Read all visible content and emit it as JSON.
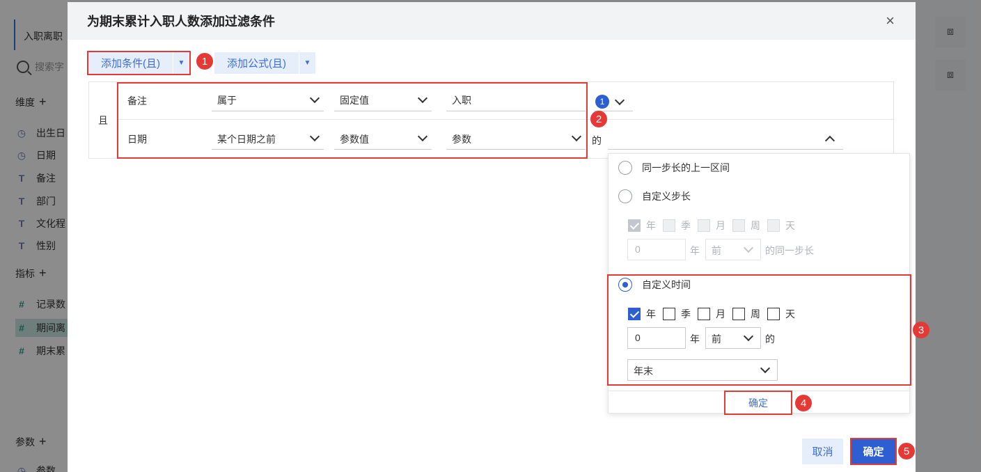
{
  "background": {
    "tab_label": "入职离职",
    "search_placeholder": "搜索字",
    "dimension_section": "维度",
    "dimension_fields": [
      "出生日",
      "日期",
      "备注",
      "部门",
      "文化程",
      "性别"
    ],
    "metric_section": "指标",
    "metric_fields": [
      "记录数",
      "期间离",
      "期末累"
    ],
    "param_section": "参数",
    "param_field": "参数"
  },
  "dialog": {
    "title": "为期末累计入职人数添加过滤条件",
    "close_icon": "×",
    "toolbar": {
      "add_condition": "添加条件(且)",
      "add_formula": "添加公式(且)",
      "caret": "▼"
    },
    "conditions": {
      "logic": "且",
      "rows": [
        {
          "field": "备注",
          "operator": "属于",
          "value_type": "固定值",
          "value": "入职",
          "badge_count": "1"
        },
        {
          "field": "日期",
          "operator": "某个日期之前",
          "value_type": "参数值",
          "value": "参数",
          "suffix": "的"
        }
      ]
    },
    "popover": {
      "option1": "同一步长的上一区间",
      "option2": "自定义步长",
      "option3": "自定义时间",
      "units": [
        "年",
        "季",
        "月",
        "周",
        "天"
      ],
      "step_value": "0",
      "step_unit": "年",
      "step_direction": "前",
      "step_suffix": "的同一步长",
      "time_value": "0",
      "time_unit": "年",
      "time_direction": "前",
      "time_suffix": "的",
      "time_point": "年末",
      "confirm": "确定",
      "selected_option": "option3"
    },
    "footer": {
      "cancel": "取消",
      "confirm": "确定"
    }
  },
  "annotations": [
    "1",
    "2",
    "3",
    "4",
    "5"
  ],
  "colors": {
    "accent": "#2d5fd3",
    "highlight": "#e53935",
    "toolbar_bg": "#e6eefb"
  }
}
